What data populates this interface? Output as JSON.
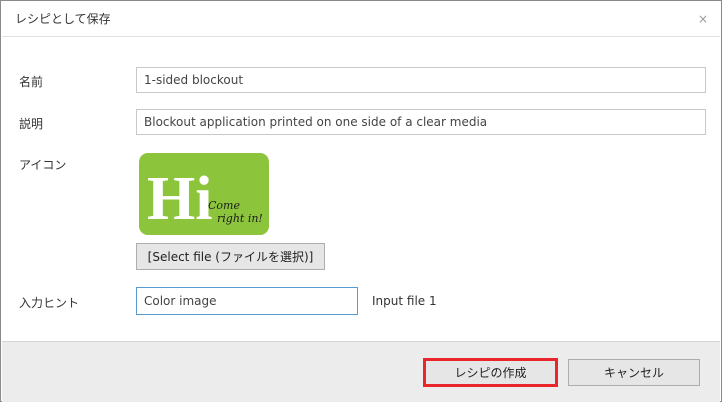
{
  "dialog": {
    "title": "レシピとして保存",
    "close_glyph": "×"
  },
  "form": {
    "name_label": "名前",
    "name_value": "1-sided blockout",
    "description_label": "説明",
    "description_value": "Blockout application printed on one side of a clear media",
    "icon_label": "アイコン",
    "icon_image": {
      "main_text": "Hi",
      "script_line1": "Come",
      "script_line2": "right in!",
      "background_color": "#8cc43c",
      "text_color": "#ffffff",
      "script_color": "#1c1c1c",
      "icon_name": "hi-come-right-in-icon"
    },
    "select_file_label": "[Select file (ファイルを選択)]",
    "input_hint_label": "入力ヒント",
    "input_hint_value": "Color image",
    "input_file_label": "Input file 1"
  },
  "footer": {
    "create_recipe_label": "レシピの作成",
    "cancel_label": "キャンセル",
    "highlight_color": "#e8262b"
  }
}
